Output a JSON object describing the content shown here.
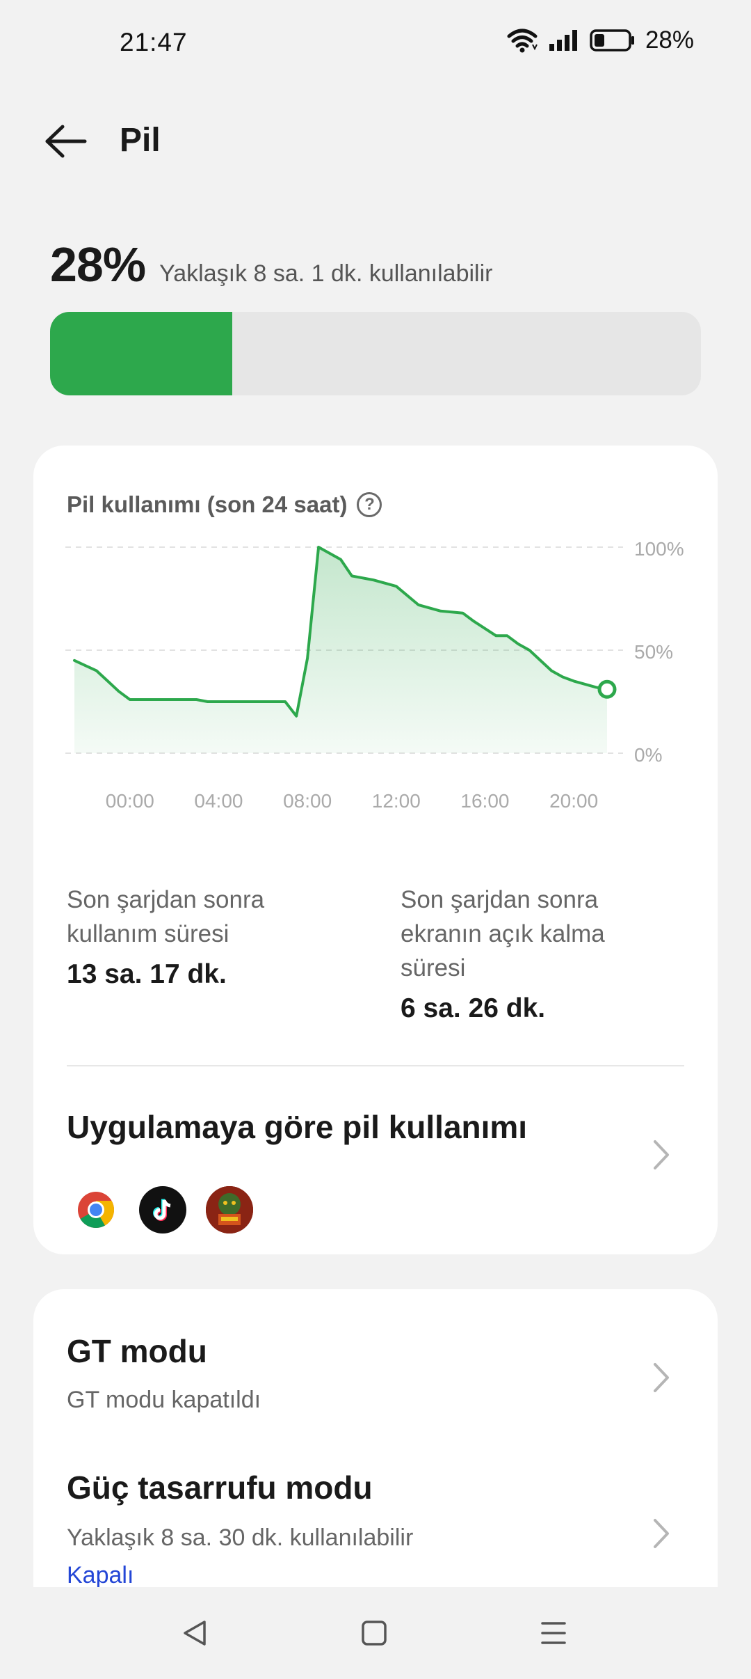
{
  "status": {
    "time": "21:47",
    "battery_text": "28%"
  },
  "header": {
    "title": "Pil"
  },
  "battery": {
    "percent_text": "28%",
    "estimate": "Yaklaşık 8 sa. 1 dk. kullanılabilir",
    "level_fraction": 0.28,
    "bar_color": "#2da84c"
  },
  "usage_card": {
    "title": "Pil kullanımı (son 24 saat)",
    "stat_left_label": "Son şarjdan sonra kullanım süresi",
    "stat_left_value": "13 sa. 17 dk.",
    "stat_right_label": "Son şarjdan sonra ekranın açık kalma süresi",
    "stat_right_value": "6 sa. 26 dk.",
    "by_app_title": "Uygulamaya göre pil kullanımı",
    "app_icons": [
      "chrome-icon",
      "tiktok-icon",
      "game-icon"
    ]
  },
  "chart_data": {
    "type": "area",
    "title": "Pil kullanımı (son 24 saat)",
    "x_tick_labels": [
      "00:00",
      "04:00",
      "08:00",
      "12:00",
      "16:00",
      "20:00"
    ],
    "y_tick_labels": [
      "100%",
      "50%",
      "0%"
    ],
    "ylim": [
      0,
      100
    ],
    "xlim": [
      -2.5,
      21.5
    ],
    "grid": true,
    "line_color": "#2da84c",
    "series": [
      {
        "x": [
          -2.5,
          -1.5,
          -1,
          -0.5,
          0,
          1,
          2,
          3,
          3.5,
          4,
          5,
          6,
          7,
          7.5,
          8,
          8.5,
          9.5,
          10,
          11,
          12,
          13,
          14,
          15,
          15.5,
          16.5,
          17,
          17.5,
          18,
          19,
          19.5,
          20,
          21,
          21.5
        ],
        "y": [
          45,
          40,
          35,
          30,
          26,
          26,
          26,
          26,
          25,
          25,
          25,
          25,
          25,
          18,
          46,
          100,
          94,
          86,
          84,
          81,
          72,
          69,
          68,
          64,
          57,
          57,
          53,
          50,
          40,
          37,
          35,
          32,
          31
        ]
      }
    ]
  },
  "settings": {
    "gt_title": "GT modu",
    "gt_sub": "GT modu kapatıldı",
    "saver_title": "Güç tasarrufu modu",
    "saver_sub": "Yaklaşık 8 sa. 30 dk. kullanılabilir",
    "saver_state": "Kapalı",
    "link_color": "#2346d6"
  },
  "navbar": {
    "icons": [
      "back-nav-icon",
      "home-nav-icon",
      "recents-nav-icon"
    ]
  }
}
